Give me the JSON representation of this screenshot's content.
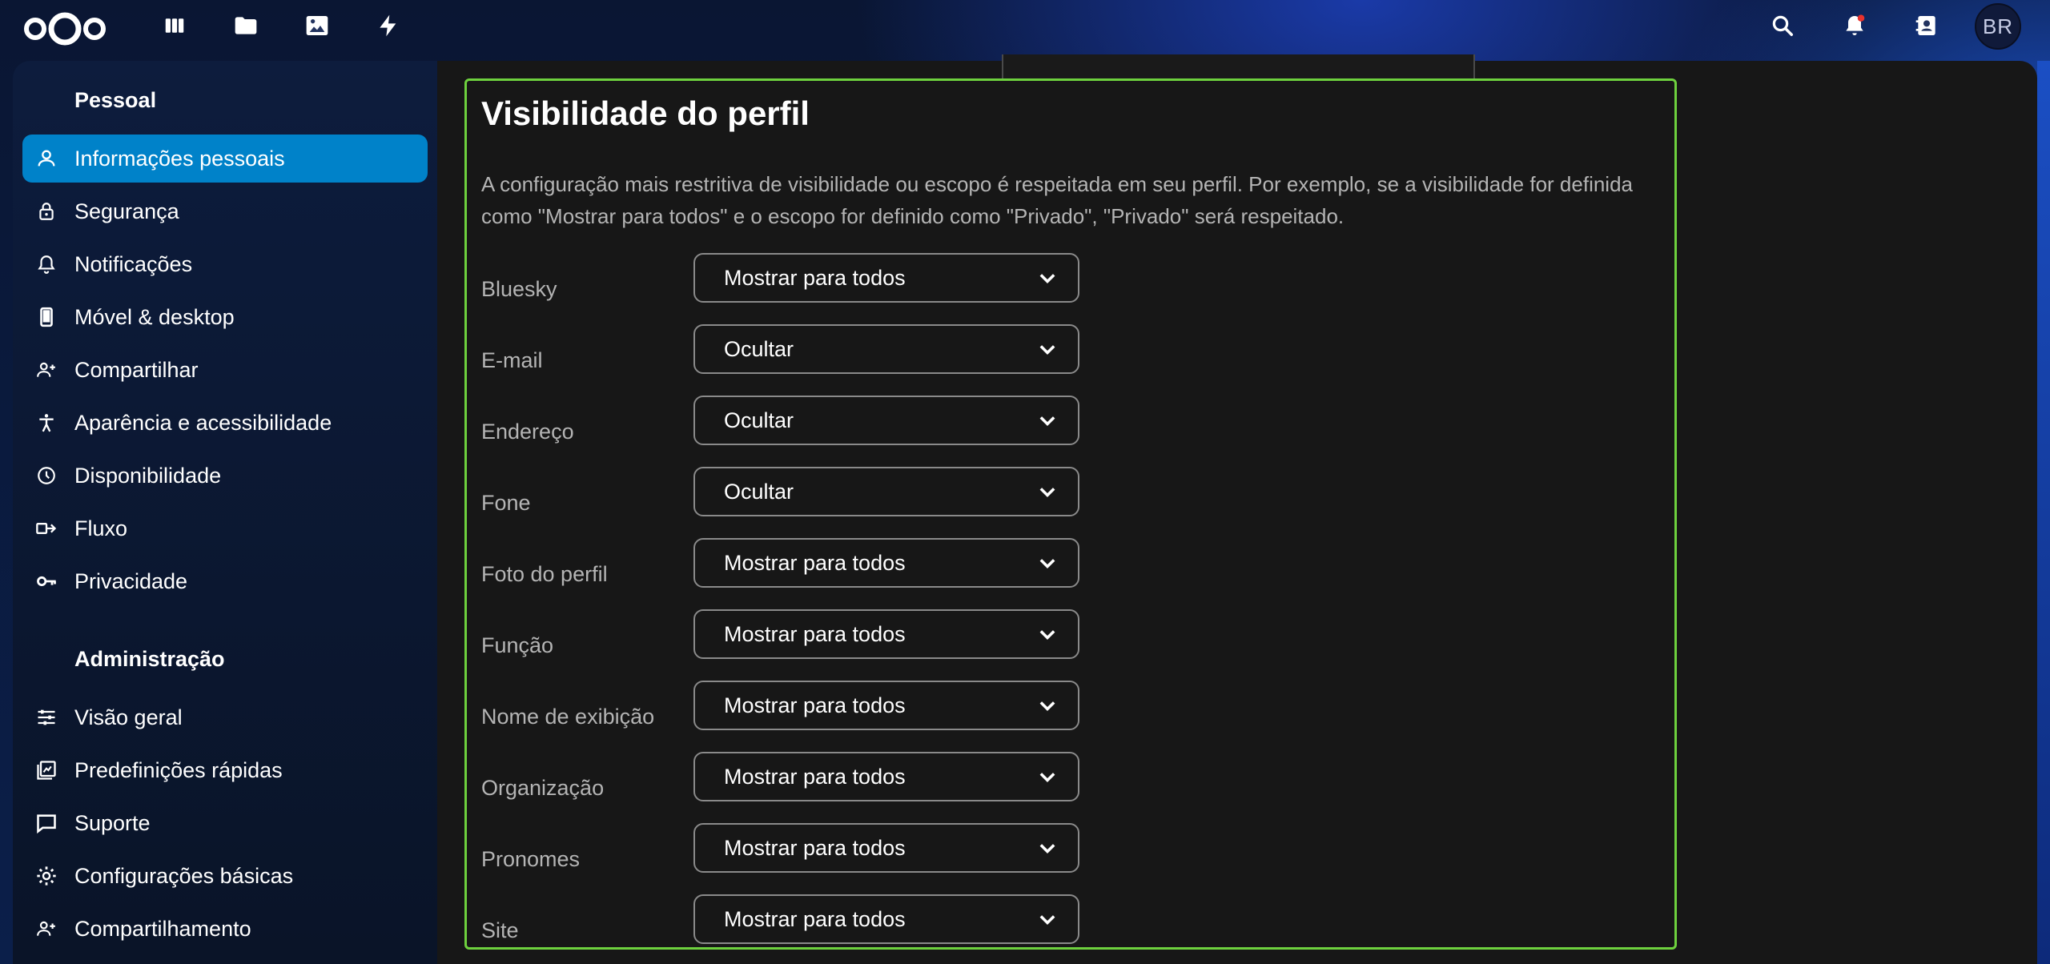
{
  "header": {
    "apps": [
      {
        "name": "dashboard-icon"
      },
      {
        "name": "files-icon"
      },
      {
        "name": "photos-icon"
      },
      {
        "name": "activity-icon"
      }
    ],
    "right_icons": [
      "search-icon",
      "notifications-icon",
      "contacts-icon"
    ],
    "avatar_initials": "BR"
  },
  "sidebar": {
    "section_personal": "Pessoal",
    "personal_items": [
      {
        "label": "Informações pessoais",
        "icon": "user-icon",
        "active": true
      },
      {
        "label": "Segurança",
        "icon": "lock-icon"
      },
      {
        "label": "Notificações",
        "icon": "bell-icon"
      },
      {
        "label": "Móvel & desktop",
        "icon": "phone-icon"
      },
      {
        "label": "Compartilhar",
        "icon": "share-user-icon"
      },
      {
        "label": "Aparência e acessibilidade",
        "icon": "accessibility-icon"
      },
      {
        "label": "Disponibilidade",
        "icon": "clock-icon"
      },
      {
        "label": "Fluxo",
        "icon": "flow-icon"
      },
      {
        "label": "Privacidade",
        "icon": "key-icon"
      }
    ],
    "section_admin": "Administração",
    "admin_items": [
      {
        "label": "Visão geral",
        "icon": "sliders-icon"
      },
      {
        "label": "Predefinições rápidas",
        "icon": "presets-icon"
      },
      {
        "label": "Suporte",
        "icon": "support-icon"
      },
      {
        "label": "Configurações básicas",
        "icon": "gear-icon"
      },
      {
        "label": "Compartilhamento",
        "icon": "share-user-icon"
      }
    ]
  },
  "main": {
    "title": "Visibilidade do perfil",
    "description": "A configuração mais restritiva de visibilidade ou escopo é respeitada em seu perfil. Por exemplo, se a visibilidade for definida como \"Mostrar para todos\" e o escopo for definido como \"Privado\", \"Privado\" será respeitado.",
    "rows": [
      {
        "label": "Bluesky",
        "value": "Mostrar para todos"
      },
      {
        "label": "E-mail",
        "value": "Ocultar"
      },
      {
        "label": "Endereço",
        "value": "Ocultar"
      },
      {
        "label": "Fone",
        "value": "Ocultar"
      },
      {
        "label": "Foto do perfil",
        "value": "Mostrar para todos"
      },
      {
        "label": "Função",
        "value": "Mostrar para todos"
      },
      {
        "label": "Nome de exibição",
        "value": "Mostrar para todos"
      },
      {
        "label": "Organização",
        "value": "Mostrar para todos"
      },
      {
        "label": "Pronomes",
        "value": "Mostrar para todos"
      },
      {
        "label": "Site",
        "value": "Mostrar para todos"
      }
    ]
  },
  "colors": {
    "accent": "#0082c9",
    "highlight_border": "#6ed13e",
    "main_bg": "#171717"
  }
}
